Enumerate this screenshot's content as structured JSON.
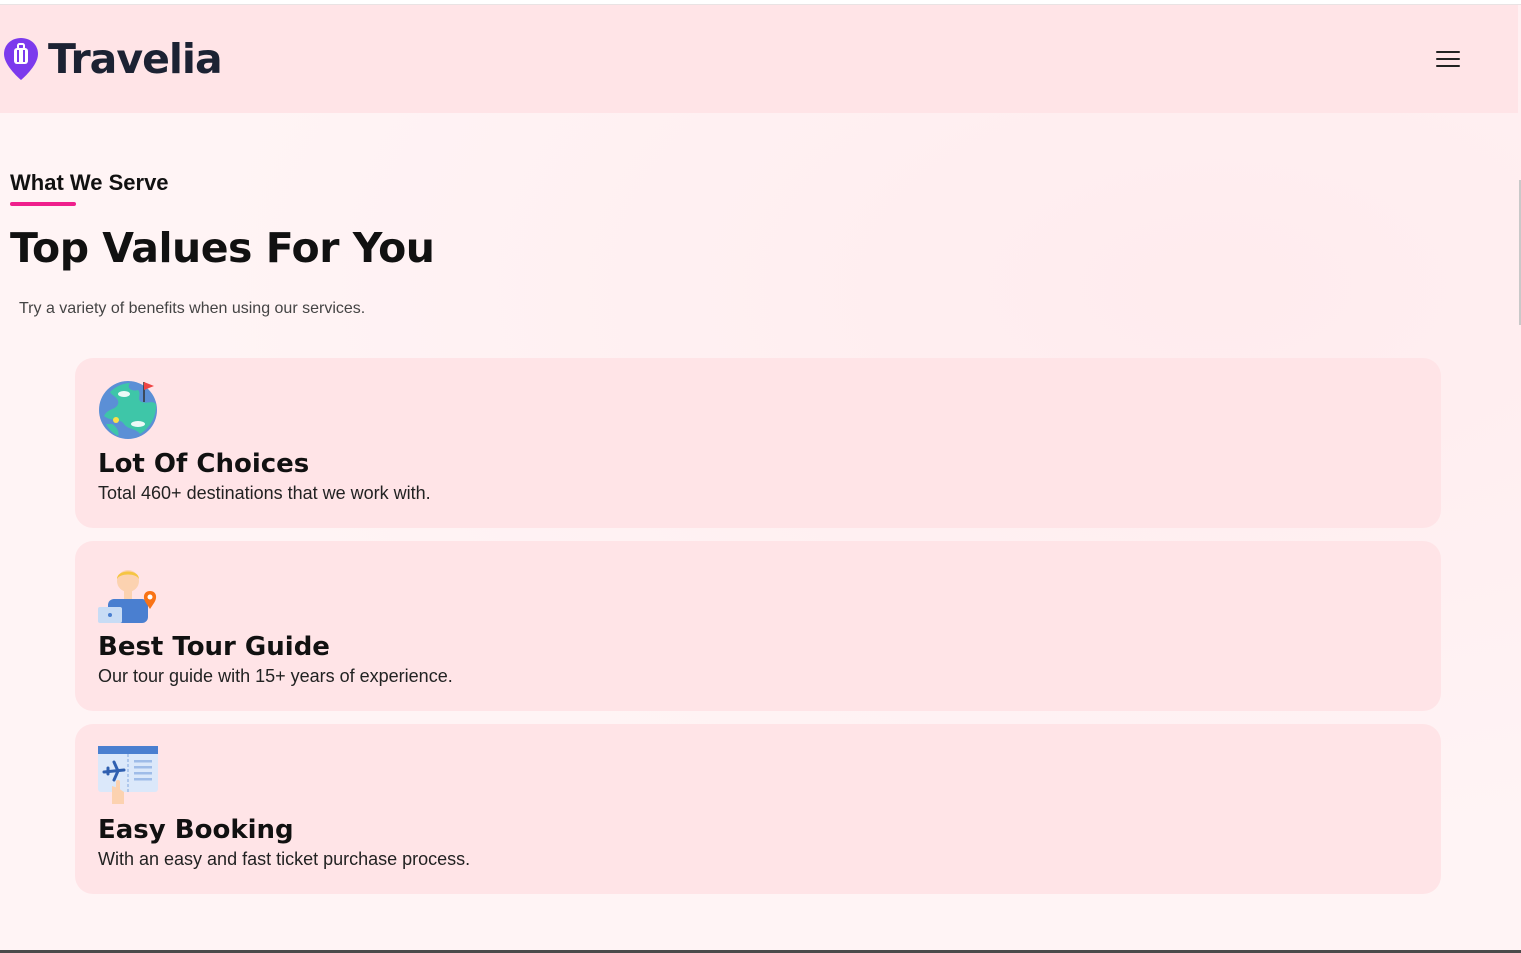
{
  "brand": {
    "name": "Travelia",
    "accent": "#7c3aed"
  },
  "header": {
    "menu_icon": "hamburger-menu-icon"
  },
  "section": {
    "tag": "What We Serve",
    "title": "Top Values For You",
    "subtitle": "Try a variety of benefits when using our services."
  },
  "cards": [
    {
      "icon": "globe-icon",
      "title": "Lot Of Choices",
      "description": "Total 460+ destinations that we work with."
    },
    {
      "icon": "tour-guide-icon",
      "title": "Best Tour Guide",
      "description": "Our tour guide with 15+ years of experience."
    },
    {
      "icon": "ticket-booking-icon",
      "title": "Easy Booking",
      "description": "With an easy and fast ticket purchase process."
    }
  ],
  "colors": {
    "header_bg": "#ffe4e7",
    "card_bg": "#ffe4e7",
    "page_bg": "#fff4f5",
    "underline": "#ef1f8c"
  }
}
